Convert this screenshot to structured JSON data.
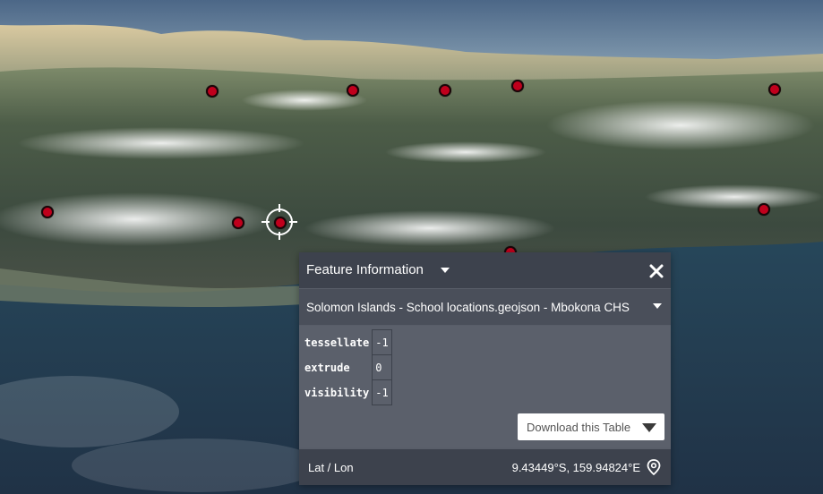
{
  "map": {
    "markers": [
      {
        "id": "m1"
      },
      {
        "id": "m2"
      },
      {
        "id": "m3"
      },
      {
        "id": "m4"
      },
      {
        "id": "m5"
      },
      {
        "id": "m6"
      },
      {
        "id": "m7"
      },
      {
        "id": "m8"
      },
      {
        "id": "m9"
      },
      {
        "id": "m10"
      }
    ],
    "marker_color": "#c0001c",
    "selected_marker_index": 7
  },
  "panel": {
    "title": "Feature Information",
    "subtitle": "Solomon Islands - School locations.geojson - Mbokona CHS",
    "properties": [
      {
        "name": "tessellate",
        "value": "-1"
      },
      {
        "name": "extrude",
        "value": "0"
      },
      {
        "name": "visibility",
        "value": "-1"
      }
    ],
    "download_label": "Download this Table",
    "footer": {
      "label": "Lat / Lon",
      "value": "9.43449°S, 159.94824°E"
    },
    "icons": {
      "title_dropdown": "chevron-down-icon",
      "close": "close-icon",
      "location": "map-pin-icon"
    }
  }
}
